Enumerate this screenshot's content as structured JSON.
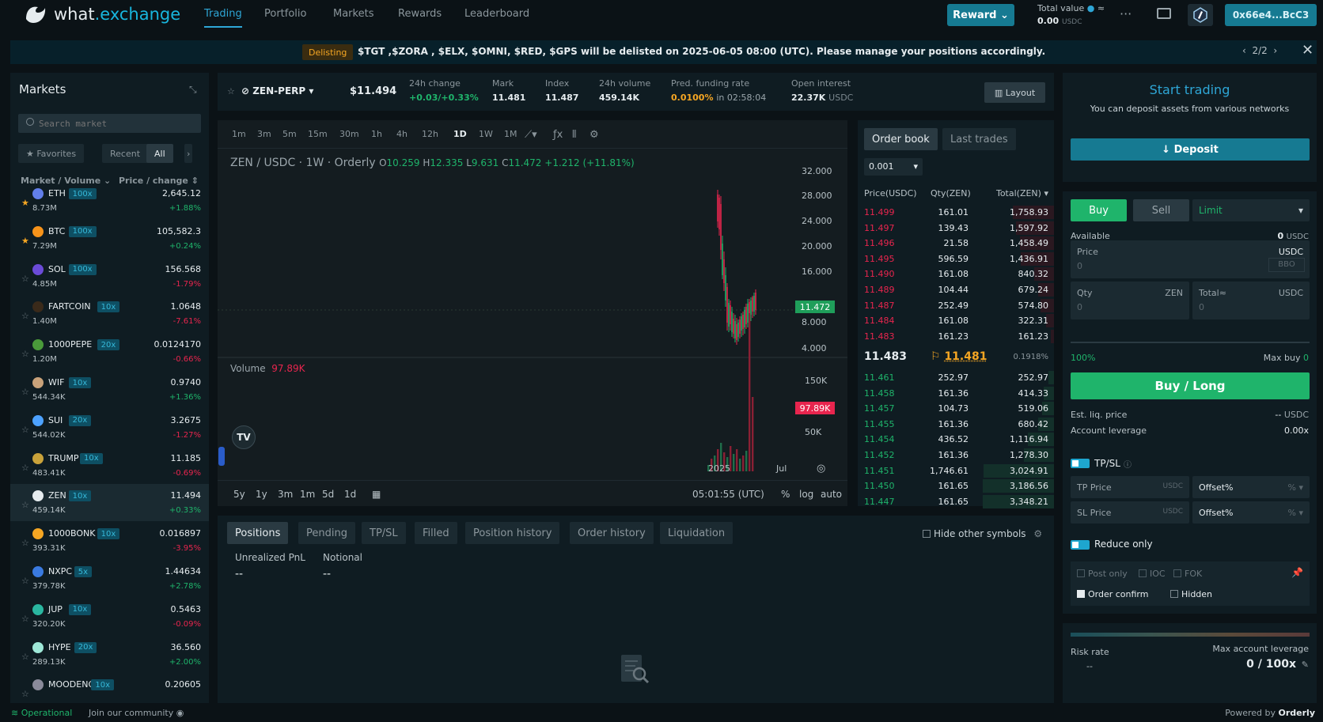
{
  "brand": {
    "name_a": "what",
    "name_b": ".exchange"
  },
  "nav": {
    "items": [
      "Trading",
      "Portfolio",
      "Markets",
      "Rewards",
      "Leaderboard"
    ]
  },
  "header": {
    "reward": "Reward ⌄",
    "total_label": "Total value",
    "total_value": "0.00",
    "total_unit": "USDC",
    "wallet": "0x66e4...BcC3",
    "more": "···"
  },
  "banner": {
    "badge": "Delisting",
    "text": "$TGT ,$ZORA , $ELX, $OMNI, $RED, $GPS will be delisted on 2025-06-05 08:00 (UTC). Please manage your positions accordingly.",
    "pager": "2/2"
  },
  "markets": {
    "title": "Markets",
    "search_placeholder": "Search market",
    "filters": [
      "★ Favorites",
      "Recent",
      "All"
    ],
    "col1": "Market / Volume ⌄",
    "col2": "Price / change ⇕",
    "rows": [
      {
        "sym": "ETH",
        "lev": "100x",
        "vol": "8.73M",
        "price": "2,645.12",
        "chg": "+1.88%",
        "up": true,
        "fav": true,
        "color": "#627eea"
      },
      {
        "sym": "BTC",
        "lev": "100x",
        "vol": "7.29M",
        "price": "105,582.3",
        "chg": "+0.24%",
        "up": true,
        "fav": true,
        "color": "#f7931a"
      },
      {
        "sym": "SOL",
        "lev": "100x",
        "vol": "4.85M",
        "price": "156.568",
        "chg": "-1.79%",
        "up": false,
        "fav": false,
        "color": "#6b4bd8"
      },
      {
        "sym": "FARTCOIN",
        "lev": "10x",
        "vol": "1.40M",
        "price": "1.0648",
        "chg": "-7.61%",
        "up": false,
        "fav": false,
        "color": "#3a2a1a"
      },
      {
        "sym": "1000PEPE",
        "lev": "20x",
        "vol": "1.20M",
        "price": "0.0124170",
        "chg": "-0.66%",
        "up": false,
        "fav": false,
        "color": "#4a9a3a"
      },
      {
        "sym": "WIF",
        "lev": "10x",
        "vol": "544.34K",
        "price": "0.9740",
        "chg": "+1.36%",
        "up": true,
        "fav": false,
        "color": "#c9a27a"
      },
      {
        "sym": "SUI",
        "lev": "20x",
        "vol": "544.02K",
        "price": "3.2675",
        "chg": "-1.27%",
        "up": false,
        "fav": false,
        "color": "#4da2ff"
      },
      {
        "sym": "TRUMP",
        "lev": "10x",
        "vol": "483.41K",
        "price": "11.185",
        "chg": "-0.69%",
        "up": false,
        "fav": false,
        "color": "#c9a23a"
      },
      {
        "sym": "ZEN",
        "lev": "10x",
        "vol": "459.14K",
        "price": "11.494",
        "chg": "+0.33%",
        "up": true,
        "fav": false,
        "color": "#e6ecef",
        "sel": true
      },
      {
        "sym": "1000BONK",
        "lev": "10x",
        "vol": "393.31K",
        "price": "0.016897",
        "chg": "-3.95%",
        "up": false,
        "fav": false,
        "color": "#f5a623"
      },
      {
        "sym": "NXPC",
        "lev": "5x",
        "vol": "379.78K",
        "price": "1.44634",
        "chg": "+2.78%",
        "up": true,
        "fav": false,
        "color": "#3a7ae0"
      },
      {
        "sym": "JUP",
        "lev": "10x",
        "vol": "320.20K",
        "price": "0.5463",
        "chg": "-0.09%",
        "up": false,
        "fav": false,
        "color": "#2ab6a0"
      },
      {
        "sym": "HYPE",
        "lev": "20x",
        "vol": "289.13K",
        "price": "36.560",
        "chg": "+2.00%",
        "up": true,
        "fav": false,
        "color": "#9fe8d8"
      },
      {
        "sym": "MOODENG",
        "lev": "10x",
        "vol": "",
        "price": "0.20605",
        "chg": "",
        "up": true,
        "fav": false,
        "color": "#8a8a9a"
      }
    ]
  },
  "ticker": {
    "symbol": "ZEN-PERP",
    "price": "$11.494",
    "change_label": "24h change",
    "change": "+0.03/+0.33%",
    "mark_label": "Mark",
    "mark": "11.481",
    "index_label": "Index",
    "index": "11.487",
    "vol_label": "24h volume",
    "vol": "459.14K",
    "fund_label": "Pred. funding rate",
    "fund": "0.0100%",
    "fund_in": "in 02:58:04",
    "oi_label": "Open interest",
    "oi": "22.37K",
    "oi_unit": "USDC",
    "layout": "Layout"
  },
  "chart": {
    "timeframes": [
      "1m",
      "3m",
      "5m",
      "15m",
      "30m",
      "1h",
      "4h",
      "12h",
      "1D",
      "1W",
      "1M"
    ],
    "legend": "ZEN / USDC · 1W · Orderly",
    "ohlc": {
      "o": "10.259",
      "h": "12.335",
      "l": "9.631",
      "c": "11.472",
      "chg": "+1.212 (+11.81%)"
    },
    "y_ticks": [
      "32.000",
      "28.000",
      "24.000",
      "20.000",
      "16.000",
      "8.000",
      "4.000"
    ],
    "last_price": "11.472",
    "volume_label": "Volume",
    "volume_value": "97.89K",
    "vol_ticks": [
      "150K",
      "50K"
    ],
    "x_ticks": [
      "2025",
      "Jul"
    ],
    "ranges": [
      "5y",
      "1y",
      "3m",
      "1m",
      "5d",
      "1d"
    ],
    "clock": "05:01:55 (UTC)",
    "opts": [
      "%",
      "log",
      "auto"
    ]
  },
  "orderbook": {
    "tabs": [
      "Order book",
      "Last trades"
    ],
    "step": "0.001",
    "headers": [
      "Price(USDC)",
      "Qty(ZEN)",
      "Total(ZEN)"
    ],
    "asks": [
      {
        "p": "11.499",
        "q": "161.01",
        "t": "1,758.93",
        "d": 0.58
      },
      {
        "p": "11.497",
        "q": "139.43",
        "t": "1,597.92",
        "d": 0.53
      },
      {
        "p": "11.496",
        "q": "21.58",
        "t": "1,458.49",
        "d": 0.48
      },
      {
        "p": "11.495",
        "q": "596.59",
        "t": "1,436.91",
        "d": 0.47
      },
      {
        "p": "11.490",
        "q": "161.08",
        "t": "840.32",
        "d": 0.28
      },
      {
        "p": "11.489",
        "q": "104.44",
        "t": "679.24",
        "d": 0.22
      },
      {
        "p": "11.487",
        "q": "252.49",
        "t": "574.80",
        "d": 0.19
      },
      {
        "p": "11.484",
        "q": "161.08",
        "t": "322.31",
        "d": 0.11
      },
      {
        "p": "11.483",
        "q": "161.23",
        "t": "161.23",
        "d": 0.05
      }
    ],
    "mid": "11.483",
    "mark": "11.481",
    "spread": "0.1918%",
    "bids": [
      {
        "p": "11.461",
        "q": "252.97",
        "t": "252.97",
        "d": 0.08
      },
      {
        "p": "11.458",
        "q": "161.36",
        "t": "414.33",
        "d": 0.14
      },
      {
        "p": "11.457",
        "q": "104.73",
        "t": "519.06",
        "d": 0.17
      },
      {
        "p": "11.455",
        "q": "161.36",
        "t": "680.42",
        "d": 0.22
      },
      {
        "p": "11.454",
        "q": "436.52",
        "t": "1,116.94",
        "d": 0.37
      },
      {
        "p": "11.452",
        "q": "161.36",
        "t": "1,278.30",
        "d": 0.42
      },
      {
        "p": "11.451",
        "q": "1,746.61",
        "t": "3,024.91",
        "d": 0.99
      },
      {
        "p": "11.450",
        "q": "161.65",
        "t": "3,186.56",
        "d": 1.0
      },
      {
        "p": "11.447",
        "q": "161.65",
        "t": "3,348.21",
        "d": 1.0
      }
    ]
  },
  "positions": {
    "tabs": [
      "Positions",
      "Pending",
      "TP/SL",
      "Filled",
      "Position history",
      "Order history",
      "Liquidation"
    ],
    "hide_other": "Hide other symbols",
    "pnl_label": "Unrealized PnL",
    "pnl": "--",
    "notional_label": "Notional",
    "notional": "--"
  },
  "start": {
    "title": "Start trading",
    "sub": "You can deposit assets from various networks",
    "deposit": "↓ Deposit"
  },
  "order": {
    "buy": "Buy",
    "sell": "Sell",
    "type": "Limit",
    "available_label": "Available",
    "available": "0",
    "available_unit": "USDC",
    "price_label": "Price",
    "price_unit": "USDC",
    "price_ph": "0",
    "bbo": "BBO",
    "qty_label": "Qty",
    "qty_unit": "ZEN",
    "qty_ph": "0",
    "total_label": "Total≈",
    "total_unit": "USDC",
    "total_ph": "0",
    "pct": "100%",
    "maxbuy_label": "Max buy",
    "maxbuy": "0",
    "submit": "Buy / Long",
    "liq_label": "Est. liq. price",
    "liq": "--",
    "liq_unit": "USDC",
    "lev_label": "Account leverage",
    "lev": "0.00x",
    "tpsl": "TP/SL",
    "tp": "TP Price",
    "sl": "SL Price",
    "unit": "USDC",
    "offset": "Offset%",
    "pct_sym": "%",
    "reduce": "Reduce only",
    "post": "Post only",
    "ioc": "IOC",
    "fok": "FOK",
    "confirm": "Order confirm",
    "hidden": "Hidden"
  },
  "risk": {
    "label": "Risk rate",
    "value": "--",
    "max_label": "Max account leverage",
    "max": "0 / 100x"
  },
  "footer": {
    "status": "Operational",
    "community": "Join our community",
    "powered": "Powered by",
    "orderly": "Orderly"
  }
}
